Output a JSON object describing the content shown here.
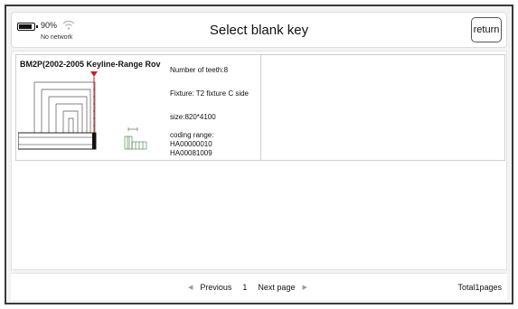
{
  "status": {
    "battery_percent": "90%",
    "battery_level": 0.9,
    "network": "No network"
  },
  "header": {
    "title": "Select blank key",
    "return_label": "return"
  },
  "key": {
    "name": "BM2P(2002-2005  Keyline-Range Rov",
    "teeth": "Number of teeth:8",
    "fixture": "Fixture: T2 fixture C side",
    "size": "size:820*4100",
    "coding_label": "coding range:",
    "coding_from": "HA00000010",
    "coding_to": "HA00081009"
  },
  "pager": {
    "prev_label": "Previous",
    "page": "1",
    "next_label": "Next page",
    "total": "Total1pages"
  },
  "colors": {
    "accent_marker": "#d21f1f",
    "border": "#3a3a3a",
    "background": "#f3f3f3"
  }
}
